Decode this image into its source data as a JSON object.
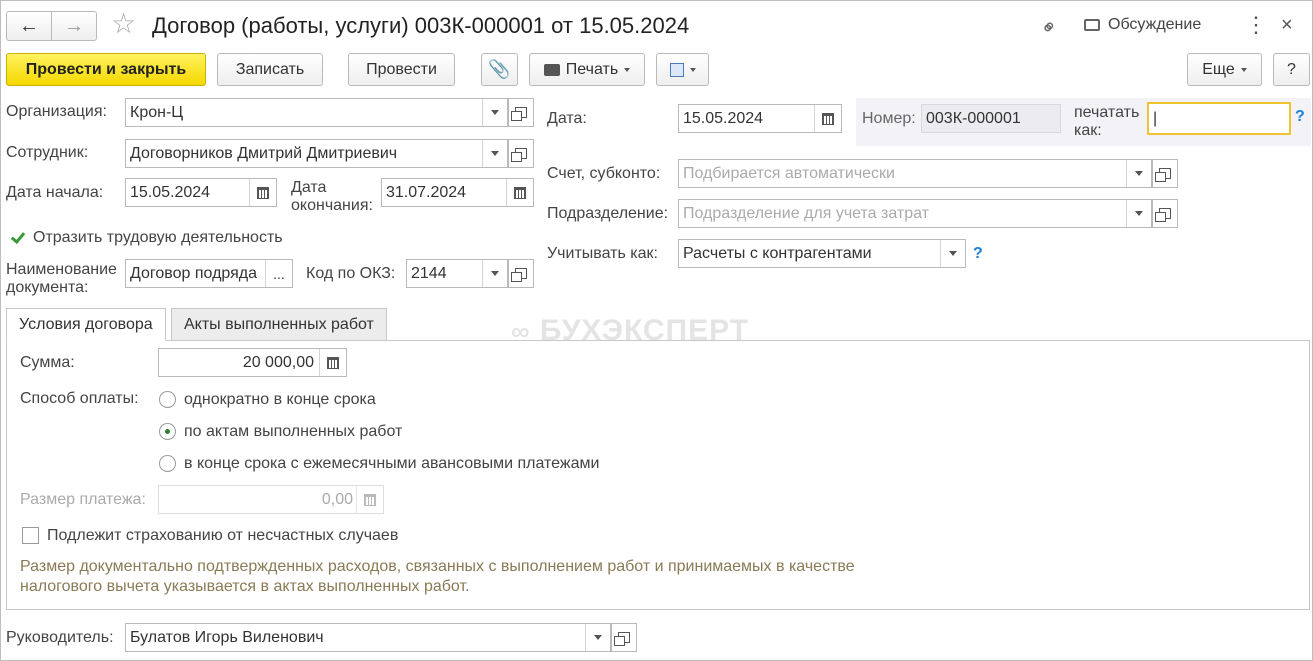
{
  "window": {
    "title": "Договор (работы, услуги) 003К-000001 от 15.05.2024",
    "discussion_label": "Обсуждение"
  },
  "toolbar": {
    "post_close_label": "Провести и закрыть",
    "save_label": "Записать",
    "post_label": "Провести",
    "print_label": "Печать",
    "more_label": "Еще",
    "help_label": "?"
  },
  "header_left": {
    "organization": {
      "label": "Организация:",
      "value": "Крон-Ц"
    },
    "employee": {
      "label": "Сотрудник:",
      "value": "Договорников Дмитрий Дмитриевич"
    },
    "start_date": {
      "label": "Дата начала:",
      "value": "15.05.2024"
    },
    "end_date": {
      "label": "Дата окончания:",
      "value": "31.07.2024"
    },
    "reflect_labor": {
      "label": "Отразить трудовую деятельность",
      "checked": true
    },
    "doc_name": {
      "label": "Наименование документа:",
      "value": "Договор подряда",
      "button": "..."
    },
    "okz": {
      "label": "Код по ОКЗ:",
      "value": "2144"
    }
  },
  "header_right": {
    "date": {
      "label": "Дата:",
      "value": "15.05.2024"
    },
    "number": {
      "label": "Номер:",
      "value": "003К-000001"
    },
    "print_as": {
      "label": "печатать как:",
      "value": "|"
    },
    "account": {
      "label": "Счет, субконто:",
      "placeholder": "Подбирается автоматически"
    },
    "division": {
      "label": "Подразделение:",
      "placeholder": "Подразделение для учета затрат"
    },
    "account_as": {
      "label": "Учитывать как:",
      "value": "Расчеты с контрагентами"
    }
  },
  "watermark": "БУХЭКСПЕРТ",
  "tabs": [
    {
      "label": "Условия договора",
      "active": true
    },
    {
      "label": "Акты выполненных работ",
      "active": false
    }
  ],
  "conditions": {
    "sum": {
      "label": "Сумма:",
      "value": "20 000,00"
    },
    "payment_method": {
      "label": "Способ оплаты:",
      "options": [
        {
          "label": "однократно в конце срока",
          "selected": false
        },
        {
          "label": "по актам выполненных работ",
          "selected": true
        },
        {
          "label": "в конце срока с ежемесячными авансовыми платежами",
          "selected": false
        }
      ]
    },
    "payment_size": {
      "label": "Размер платежа:",
      "value": "0,00"
    },
    "insurance": {
      "label": "Подлежит страхованию от несчастных случаев",
      "checked": false
    },
    "note": "Размер документально подтвержденных расходов, связанных с выполнением работ и принимаемых в качестве налогового вычета указывается в актах выполненных работ."
  },
  "footer": {
    "manager": {
      "label": "Руководитель:",
      "value": "Булатов Игорь Виленович"
    }
  },
  "colors": {
    "primary_button": "#f5d800",
    "accent_help": "#1a7fd4",
    "check": "#3a9a3a",
    "note_text": "#8a7a55"
  }
}
